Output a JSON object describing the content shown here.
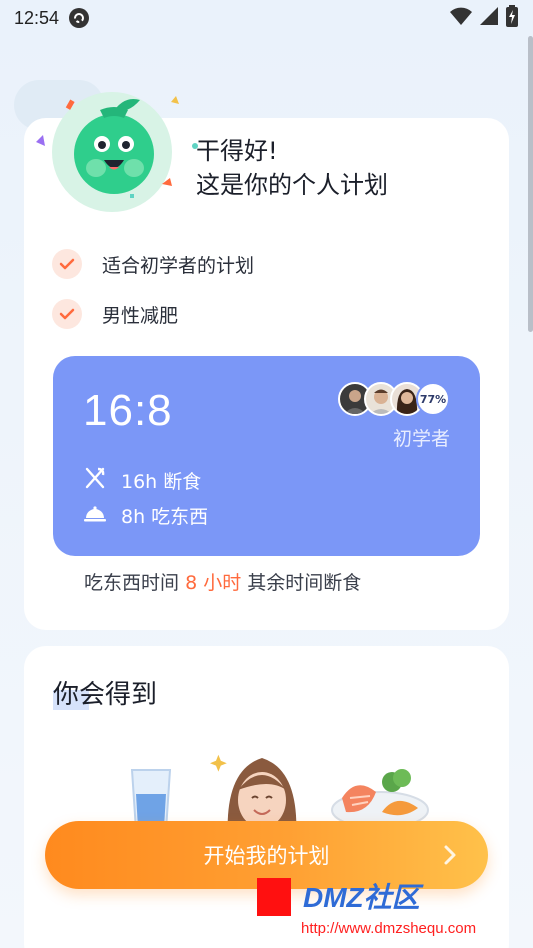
{
  "status_bar": {
    "time": "12:54",
    "icons": [
      "app-circle-icon",
      "wifi-icon",
      "signal-icon",
      "battery-charging-icon"
    ]
  },
  "plan_card": {
    "headline_line1": "干得好!",
    "headline_line2": "这是你的个人计划",
    "checks": [
      {
        "label": "适合初学者的计划",
        "icon": "check-icon"
      },
      {
        "label": "男性减肥",
        "icon": "check-icon"
      }
    ],
    "plan": {
      "ratio": "16:8",
      "fasting": "16h 断食",
      "eating": "8h 吃东西",
      "percent": "77%",
      "level": "初学者"
    },
    "note_prefix": "吃东西时间",
    "note_highlight": "8 小时",
    "note_suffix": "其余时间断食"
  },
  "gain_card": {
    "title": "你会得到",
    "illustrations": [
      "water-glass-icon",
      "smiling-woman-icon",
      "salmon-vegetables-icon"
    ]
  },
  "cta": {
    "label": "开始我的计划",
    "icon": "chevron-right-icon"
  },
  "watermark": {
    "brand": "DMZ社区",
    "url": "http://www.dmzshequ.com"
  },
  "colors": {
    "plan_box": "#7b97f7",
    "accent_orange": "#ff6a3d",
    "cta_start": "#ff8a1e",
    "cta_end": "#ffc14a",
    "check_bg": "#fde7df",
    "mascot_bg": "#d8f3e6"
  }
}
